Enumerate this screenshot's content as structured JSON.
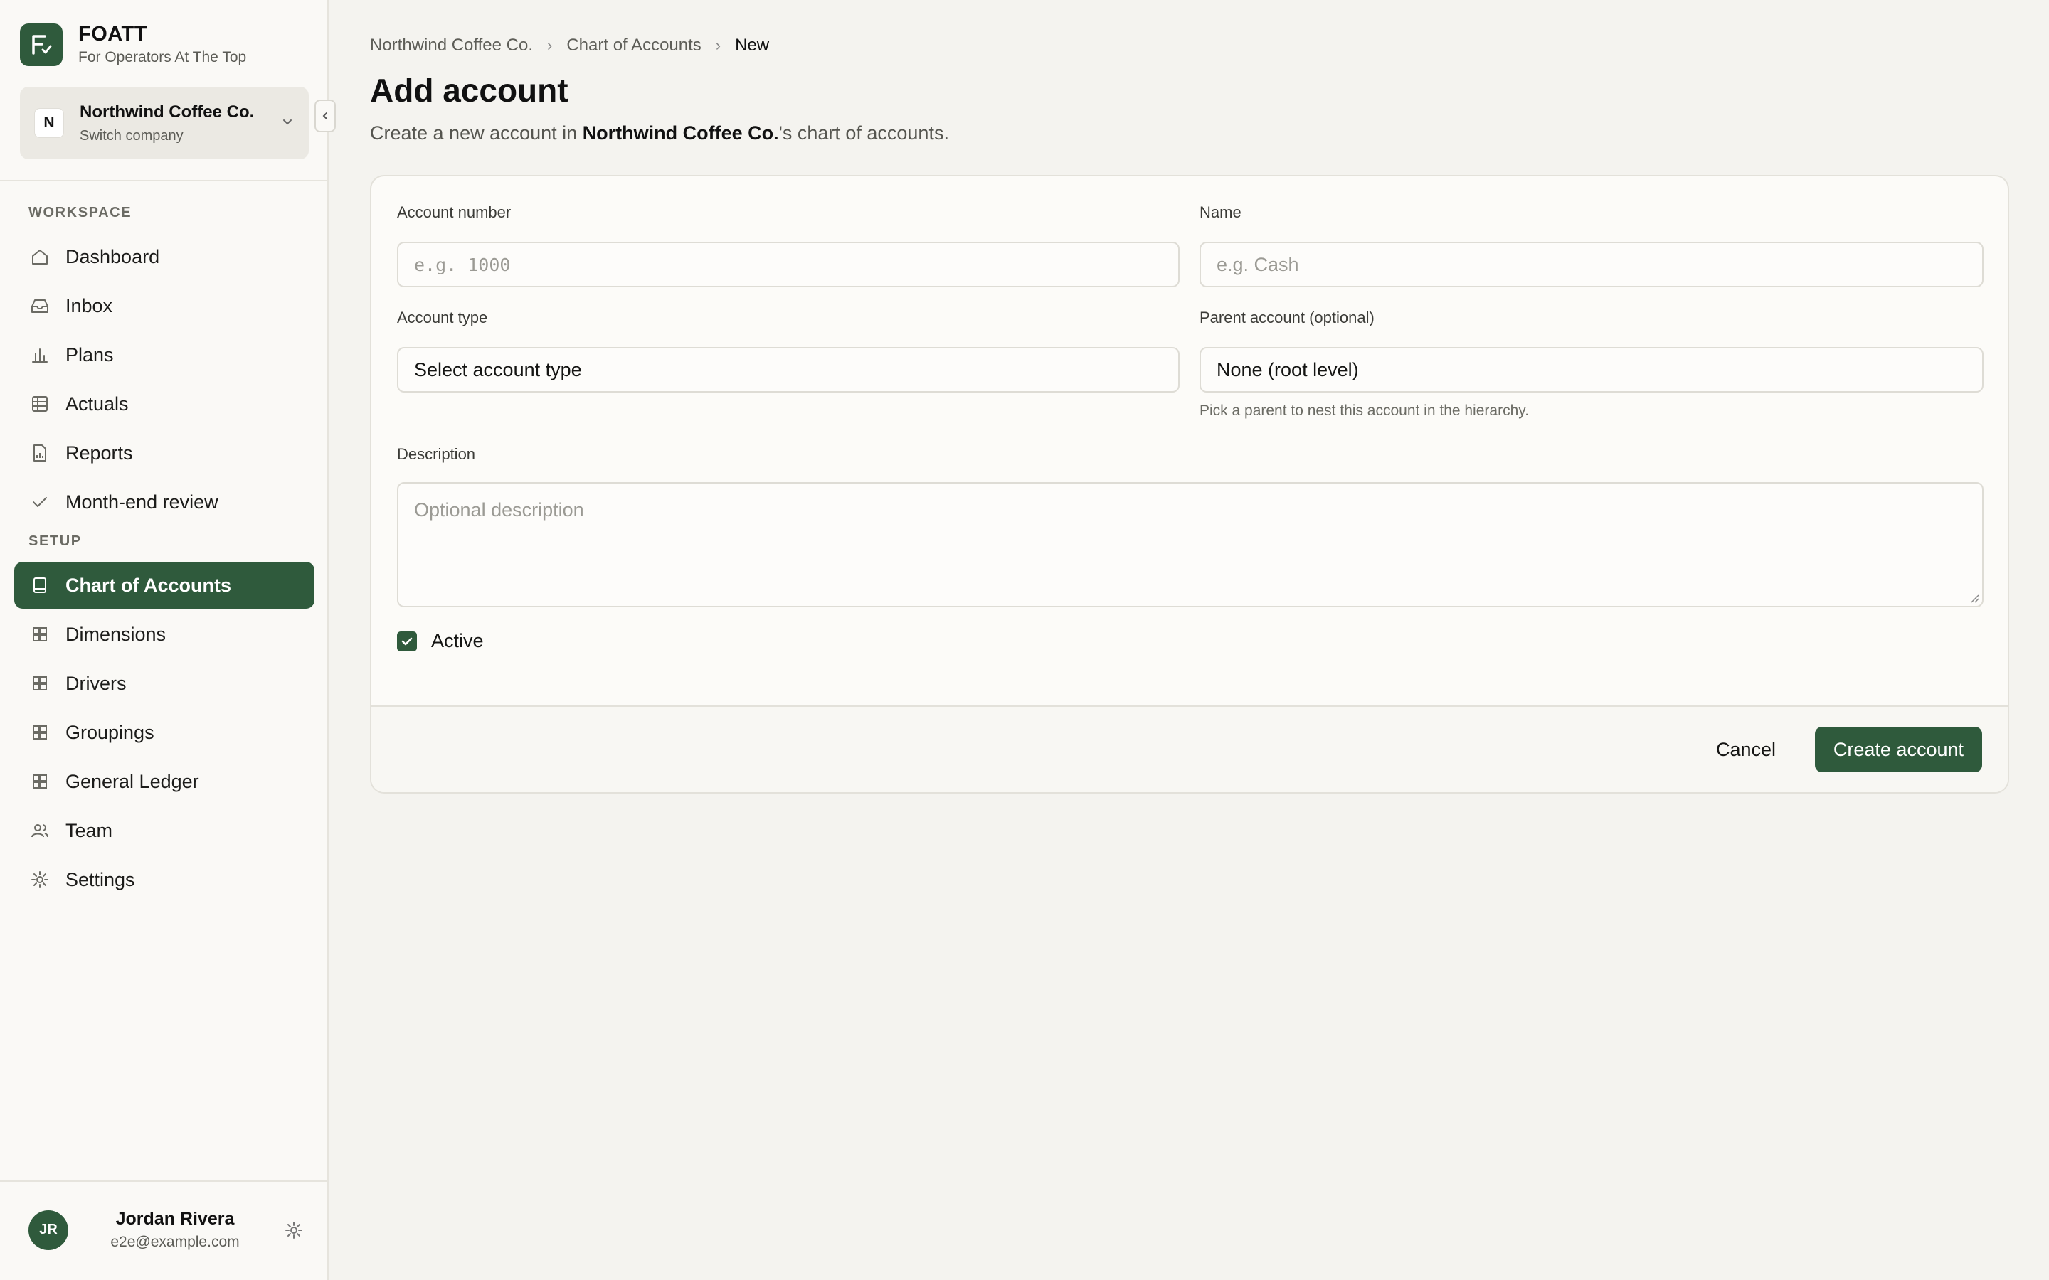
{
  "brand": {
    "name": "FOATT",
    "tagline": "For Operators At The Top"
  },
  "company": {
    "initial": "N",
    "name": "Northwind Coffee Co.",
    "switch_label": "Switch company"
  },
  "sidebar": {
    "workspace_label": "WORKSPACE",
    "workspace_items": [
      {
        "label": "Dashboard",
        "icon": "home-icon"
      },
      {
        "label": "Inbox",
        "icon": "inbox-icon"
      },
      {
        "label": "Plans",
        "icon": "bar-chart-icon"
      },
      {
        "label": "Actuals",
        "icon": "table-icon"
      },
      {
        "label": "Reports",
        "icon": "report-icon"
      },
      {
        "label": "Month-end review",
        "icon": "check-icon"
      }
    ],
    "setup_label": "SETUP",
    "setup_items": [
      {
        "label": "Chart of Accounts",
        "icon": "book-icon",
        "active": true
      },
      {
        "label": "Dimensions",
        "icon": "grid-icon"
      },
      {
        "label": "Drivers",
        "icon": "grid-icon"
      },
      {
        "label": "Groupings",
        "icon": "grid-icon"
      },
      {
        "label": "General Ledger",
        "icon": "grid-icon"
      },
      {
        "label": "Team",
        "icon": "users-icon"
      },
      {
        "label": "Settings",
        "icon": "gear-icon"
      }
    ]
  },
  "user": {
    "initials": "JR",
    "name": "Jordan Rivera",
    "email": "e2e@example.com"
  },
  "breadcrumb": [
    "Northwind Coffee Co.",
    "Chart of Accounts",
    "New"
  ],
  "page": {
    "title": "Add account",
    "subtitle_prefix": "Create a new account in ",
    "subtitle_company": "Northwind Coffee Co.",
    "subtitle_suffix": "'s chart of accounts."
  },
  "form": {
    "account_number": {
      "label": "Account number",
      "placeholder": "e.g. 1000"
    },
    "name": {
      "label": "Name",
      "placeholder": "e.g. Cash"
    },
    "account_type": {
      "label": "Account type",
      "value": "Select account type"
    },
    "parent_account": {
      "label": "Parent account (optional)",
      "value": "None (root level)",
      "help": "Pick a parent to nest this account in the hierarchy."
    },
    "description": {
      "label": "Description",
      "placeholder": "Optional description"
    },
    "active": {
      "label": "Active",
      "checked": true
    },
    "cancel_label": "Cancel",
    "submit_label": "Create account"
  },
  "colors": {
    "accent": "#2f5a3c",
    "background": "#f4f3ef",
    "sidebar": "#faf9f6"
  }
}
